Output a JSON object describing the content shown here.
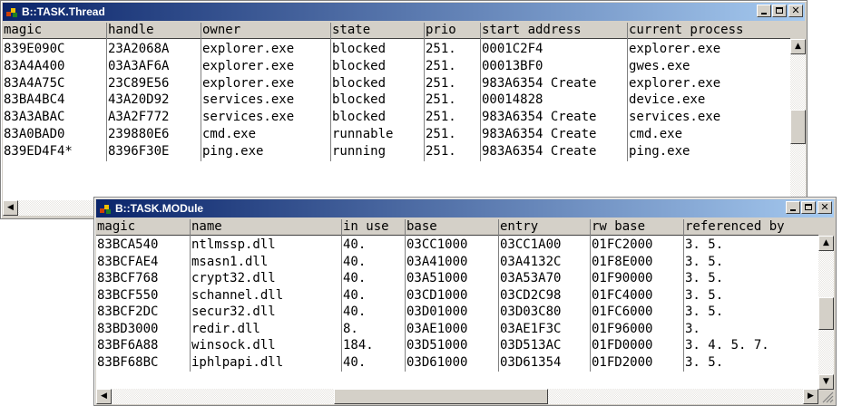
{
  "thread_window": {
    "title": "B::TASK.Thread",
    "columns": [
      "magic",
      "handle",
      "owner",
      "state",
      "prio",
      "start address",
      "current process"
    ],
    "rows": [
      [
        "839E090C",
        "23A2068A",
        "explorer.exe",
        "blocked",
        "251.",
        "0001C2F4",
        "explorer.exe"
      ],
      [
        "83A4A400",
        "03A3AF6A",
        "explorer.exe",
        "blocked",
        "251.",
        "00013BF0",
        "gwes.exe"
      ],
      [
        "83A4A75C",
        "23C89E56",
        "explorer.exe",
        "blocked",
        "251.",
        "983A6354 Create",
        "explorer.exe"
      ],
      [
        "83BA4BC4",
        "43A20D92",
        "services.exe",
        "blocked",
        "251.",
        "00014828",
        "device.exe"
      ],
      [
        "83A3ABAC",
        "A3A2F772",
        "services.exe",
        "blocked",
        "251.",
        "983A6354 Create",
        "services.exe"
      ],
      [
        "83A0BAD0",
        "239880E6",
        "cmd.exe",
        "runnable",
        "251.",
        "983A6354 Create",
        "cmd.exe"
      ],
      [
        "839ED4F4*",
        "8396F30E",
        "ping.exe",
        "running",
        "251.",
        "983A6354 Create",
        "ping.exe"
      ]
    ]
  },
  "module_window": {
    "title": "B::TASK.MODule",
    "columns": [
      "magic",
      "name",
      "in use",
      "base",
      "entry",
      "rw base",
      "referenced by"
    ],
    "rows": [
      [
        "83BCA540",
        "ntlmssp.dll",
        "40.",
        "03CC1000",
        "03CC1A00",
        "01FC2000",
        "3. 5."
      ],
      [
        "83BCFAE4",
        "msasn1.dll",
        "40.",
        "03A41000",
        "03A4132C",
        "01F8E000",
        "3. 5."
      ],
      [
        "83BCF768",
        "crypt32.dll",
        "40.",
        "03A51000",
        "03A53A70",
        "01F90000",
        "3. 5."
      ],
      [
        "83BCF550",
        "schannel.dll",
        "40.",
        "03CD1000",
        "03CD2C98",
        "01FC4000",
        "3. 5."
      ],
      [
        "83BCF2DC",
        "secur32.dll",
        "40.",
        "03D01000",
        "03D03C80",
        "01FC6000",
        "3. 5."
      ],
      [
        "83BD3000",
        "redir.dll",
        "8.",
        "03AE1000",
        "03AE1F3C",
        "01F96000",
        "3."
      ],
      [
        "83BF6A88",
        "winsock.dll",
        "184.",
        "03D51000",
        "03D513AC",
        "01FD0000",
        "3. 4. 5. 7."
      ],
      [
        "83BF68BC",
        "iphlpapi.dll",
        "40.",
        "03D61000",
        "03D61354",
        "01FD2000",
        "3. 5."
      ]
    ]
  },
  "icons": {
    "window_icon": "trace32-window-icon",
    "minimize": "minimize-icon",
    "maximize": "maximize-icon",
    "close": "close-icon",
    "close_glyph": "✕",
    "arrow_up": "▲",
    "arrow_down": "▼",
    "arrow_left": "◀",
    "arrow_right": "▶"
  },
  "colors": {
    "title_gradient_start": "#0a246a",
    "title_gradient_end": "#a6caf0",
    "face": "#d4d0c8",
    "list_bg": "#ffffff"
  }
}
